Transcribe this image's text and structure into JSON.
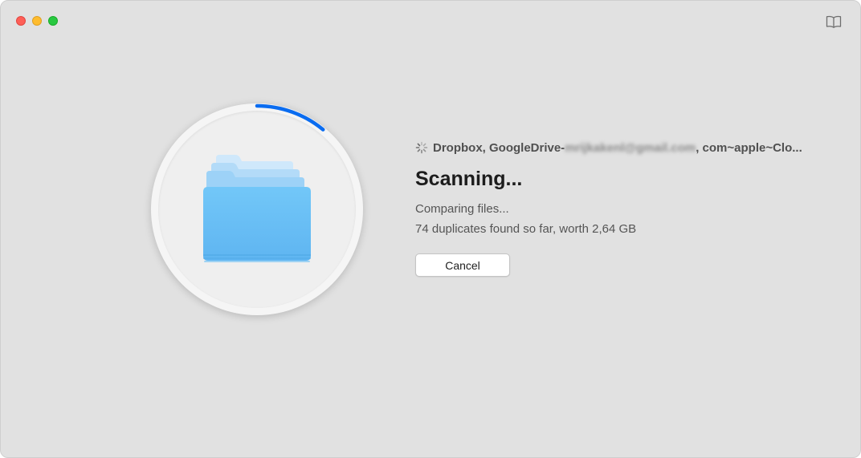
{
  "window": {
    "controls": [
      "close",
      "minimize",
      "zoom"
    ],
    "toolbar_icon": "book-icon"
  },
  "scan": {
    "progress_percent": 11,
    "sources": {
      "prefix": "Dropbox, GoogleDrive-",
      "redacted": "mrijkakenl@gmail.com",
      "suffix": ", com~apple~Clo..."
    },
    "title": "Scanning...",
    "status": "Comparing files...",
    "found": "74 duplicates found so far, worth 2,64 GB",
    "cancel_label": "Cancel"
  },
  "colors": {
    "accent": "#0a6cf0",
    "folder_light": "#8ecbf5",
    "folder_main": "#5fbcf5"
  }
}
